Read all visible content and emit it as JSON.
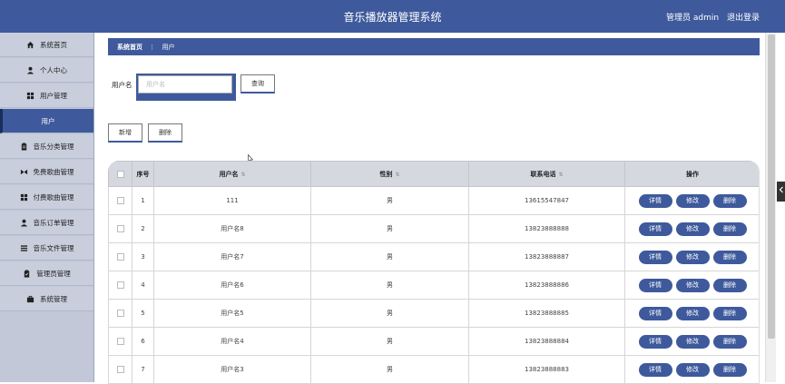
{
  "header": {
    "title": "音乐播放器管理系统",
    "admin_label": "管理员 admin",
    "logout_label": "退出登录"
  },
  "sidebar": {
    "items": [
      {
        "label": "系统首页",
        "icon": "home-icon"
      },
      {
        "label": "个人中心",
        "icon": "user-icon"
      },
      {
        "label": "用户管理",
        "icon": "grid-icon"
      },
      {
        "label": "用户",
        "icon": ""
      },
      {
        "label": "音乐分类管理",
        "icon": "clipboard-icon"
      },
      {
        "label": "免费歌曲管理",
        "icon": "bowtie-icon"
      },
      {
        "label": "付费歌曲管理",
        "icon": "grid-icon"
      },
      {
        "label": "音乐订单管理",
        "icon": "user-icon"
      },
      {
        "label": "音乐文件管理",
        "icon": "list-icon"
      },
      {
        "label": "管理员管理",
        "icon": "clipboard-icon"
      },
      {
        "label": "系统管理",
        "icon": "briefcase-icon"
      }
    ]
  },
  "breadcrumb": {
    "home": "系统首页",
    "sep": "⋮",
    "current": "用户"
  },
  "search": {
    "label": "用户名",
    "placeholder": "用户名",
    "query_label": "查询"
  },
  "actions": {
    "add_label": "新增",
    "delete_label": "删除"
  },
  "table": {
    "headers": {
      "index": "序号",
      "username": "用户名",
      "gender": "性别",
      "phone": "联系电话",
      "ops": "操作"
    },
    "sort_icon": "⇅",
    "ops_labels": {
      "detail": "详情",
      "edit": "修改",
      "delete": "删除"
    },
    "rows": [
      {
        "index": "1",
        "username": "111",
        "gender": "男",
        "phone": "13615547847"
      },
      {
        "index": "2",
        "username": "用户名8",
        "gender": "男",
        "phone": "13823888888"
      },
      {
        "index": "3",
        "username": "用户名7",
        "gender": "男",
        "phone": "13823888887"
      },
      {
        "index": "4",
        "username": "用户名6",
        "gender": "男",
        "phone": "13823888886"
      },
      {
        "index": "5",
        "username": "用户名5",
        "gender": "男",
        "phone": "13823888885"
      },
      {
        "index": "6",
        "username": "用户名4",
        "gender": "男",
        "phone": "13823888884"
      },
      {
        "index": "7",
        "username": "用户名3",
        "gender": "男",
        "phone": "13823888883"
      }
    ]
  },
  "colors": {
    "primary": "#3e5a9c",
    "sidebar_bg": "#c2c8d8"
  }
}
